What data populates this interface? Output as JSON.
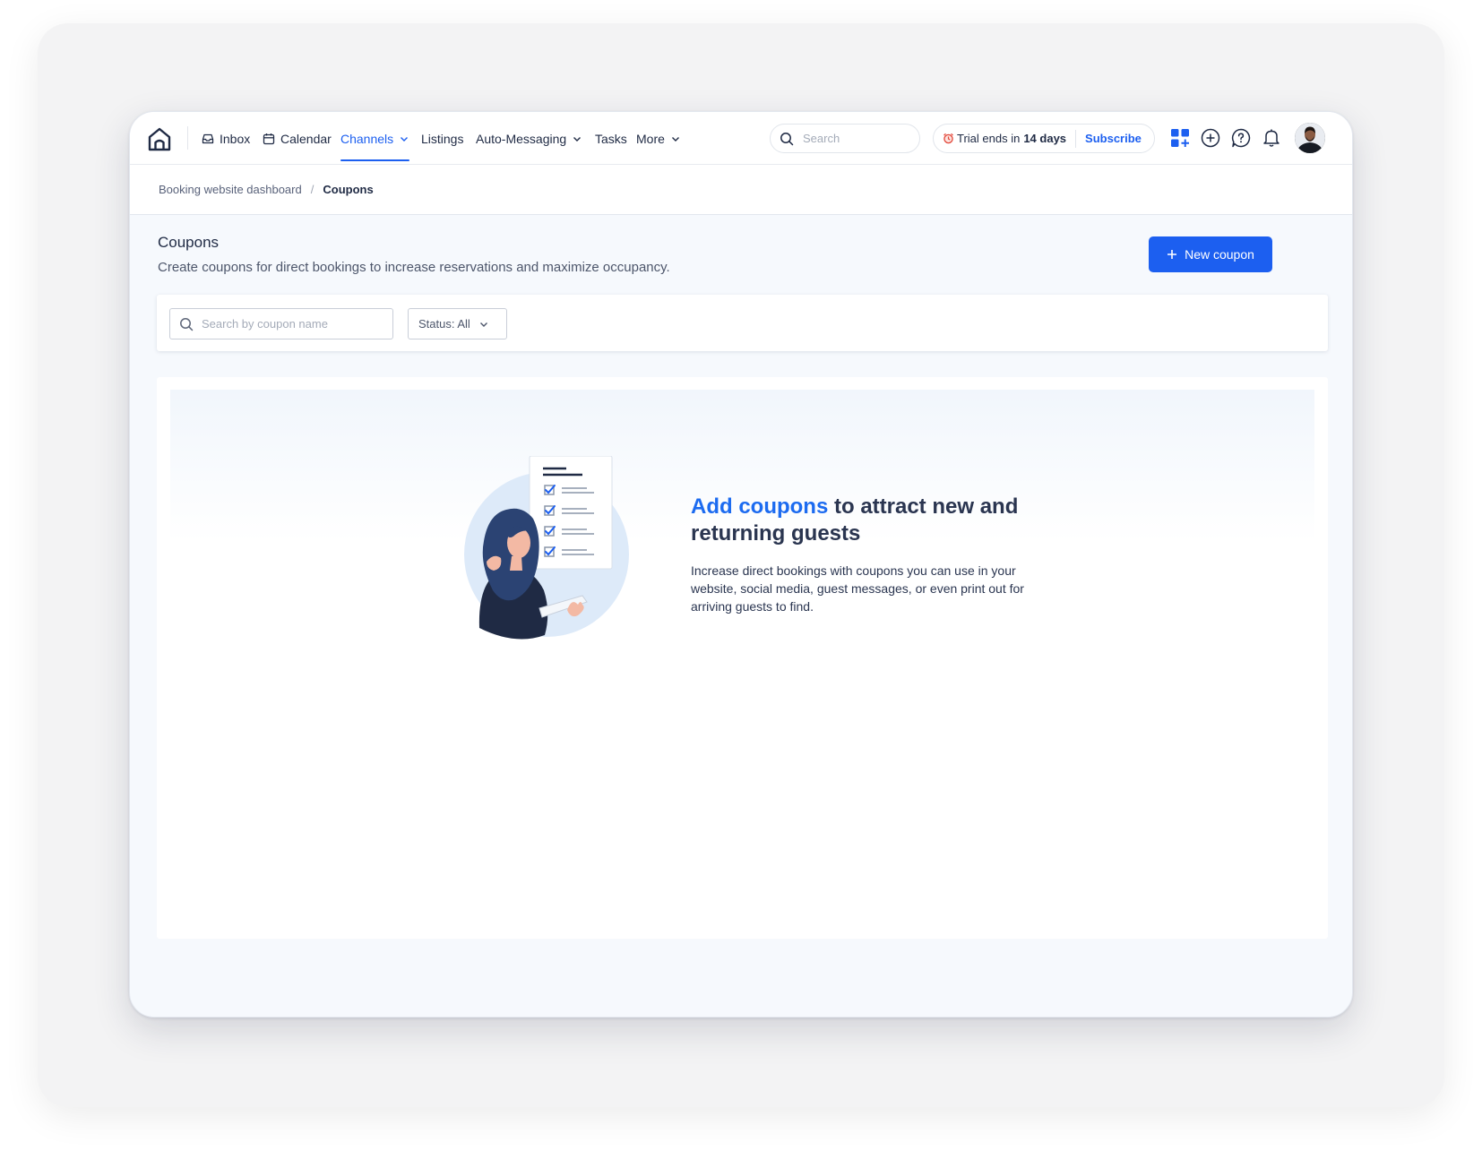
{
  "nav": {
    "items": [
      {
        "label": "Inbox",
        "icon": "inbox-icon"
      },
      {
        "label": "Calendar",
        "icon": "calendar-icon"
      },
      {
        "label": "Channels",
        "active": true,
        "has_dropdown": true
      },
      {
        "label": "Listings"
      },
      {
        "label": "Auto-Messaging",
        "has_dropdown": true
      },
      {
        "label": "Tasks"
      },
      {
        "label": "More",
        "has_dropdown": true
      }
    ],
    "search_placeholder": "Search",
    "trial": {
      "prefix": "Trial ends in",
      "days": "14 days",
      "subscribe_label": "Subscribe"
    }
  },
  "breadcrumb": {
    "parent": "Booking website dashboard",
    "separator": "/",
    "current": "Coupons"
  },
  "page": {
    "title": "Coupons",
    "subtitle": "Create coupons for direct bookings to increase reservations and maximize occupancy.",
    "new_button_label": "New coupon"
  },
  "filters": {
    "search_placeholder": "Search by coupon name",
    "status_label": "Status: All"
  },
  "empty_state": {
    "heading_accent": "Add coupons",
    "heading_rest": " to attract new and returning guests",
    "body": "Increase direct bookings with coupons you can use in your website, social media, guest messages, or even print out for arriving guests to find."
  },
  "colors": {
    "accent": "#1c5ff0",
    "text": "#1f2a44",
    "muted": "#4d566b"
  }
}
